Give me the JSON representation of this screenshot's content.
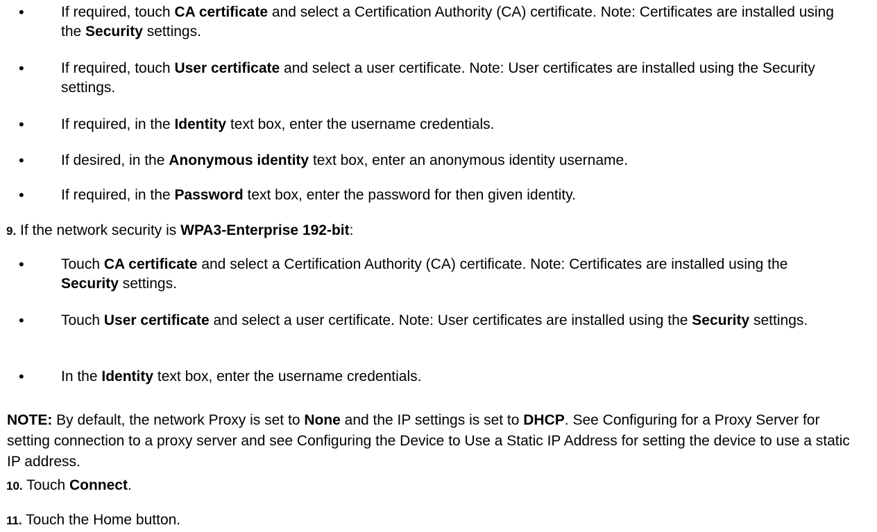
{
  "bullets_group_1": [
    {
      "parts": [
        {
          "t": "If required, touch "
        },
        {
          "t": "CA certificate",
          "b": true
        },
        {
          "t": " and select a Certification Authority (CA) certificate. Note: Certificates are installed using the "
        },
        {
          "t": "Security",
          "b": true
        },
        {
          "t": " settings."
        }
      ]
    },
    {
      "parts": [
        {
          "t": "If required, touch "
        },
        {
          "t": "User certificate",
          "b": true
        },
        {
          "t": " and select a user certificate. Note: User certificates are installed using the Security settings."
        }
      ]
    },
    {
      "parts": [
        {
          "t": "If required, in the "
        },
        {
          "t": "Identity",
          "b": true
        },
        {
          "t": " text box, enter the username credentials."
        }
      ]
    },
    {
      "parts": [
        {
          "t": "If desired, in the "
        },
        {
          "t": "Anonymous identity",
          "b": true
        },
        {
          "t": " text box, enter an anonymous identity username."
        }
      ]
    },
    {
      "parts": [
        {
          "t": "If required, in the "
        },
        {
          "t": "Password",
          "b": true
        },
        {
          "t": " text box, enter the password for then given identity."
        }
      ]
    }
  ],
  "step_9": {
    "number": "9.",
    "parts": [
      {
        "t": "If the network security is "
      },
      {
        "t": "WPA3-Enterprise 192-bit",
        "b": true
      },
      {
        "t": ":"
      }
    ]
  },
  "bullets_group_2": [
    {
      "parts": [
        {
          "t": "Touch "
        },
        {
          "t": "CA certificate",
          "b": true
        },
        {
          "t": " and select a Certification Authority (CA) certificate. Note: Certificates are installed using the "
        },
        {
          "t": "Security",
          "b": true
        },
        {
          "t": " settings."
        }
      ]
    },
    {
      "parts": [
        {
          "t": "Touch "
        },
        {
          "t": "User certificate",
          "b": true
        },
        {
          "t": " and select a user certificate. Note: User certificates are installed using the "
        },
        {
          "t": "Security",
          "b": true
        },
        {
          "t": " settings."
        }
      ]
    },
    {
      "parts": [
        {
          "t": "In the "
        },
        {
          "t": "Identity",
          "b": true
        },
        {
          "t": " text box, enter the username credentials."
        }
      ]
    }
  ],
  "note": {
    "parts": [
      {
        "t": "NOTE:",
        "b": true
      },
      {
        "t": " By default, the network Proxy is set to "
      },
      {
        "t": "None",
        "b": true
      },
      {
        "t": " and the IP settings is set to "
      },
      {
        "t": "DHCP",
        "b": true
      },
      {
        "t": ". See Configuring for a Proxy Server for setting connection to a proxy server and see Configuring the Device to Use a Static IP Address for setting the device to use a static IP address."
      }
    ]
  },
  "step_10": {
    "number": "10.",
    "parts": [
      {
        "t": " Touch "
      },
      {
        "t": "Connect",
        "b": true
      },
      {
        "t": "."
      }
    ]
  },
  "step_11": {
    "number": "11.",
    "parts": [
      {
        "t": " Touch the Home button."
      }
    ]
  },
  "bullet_symbol": "•"
}
